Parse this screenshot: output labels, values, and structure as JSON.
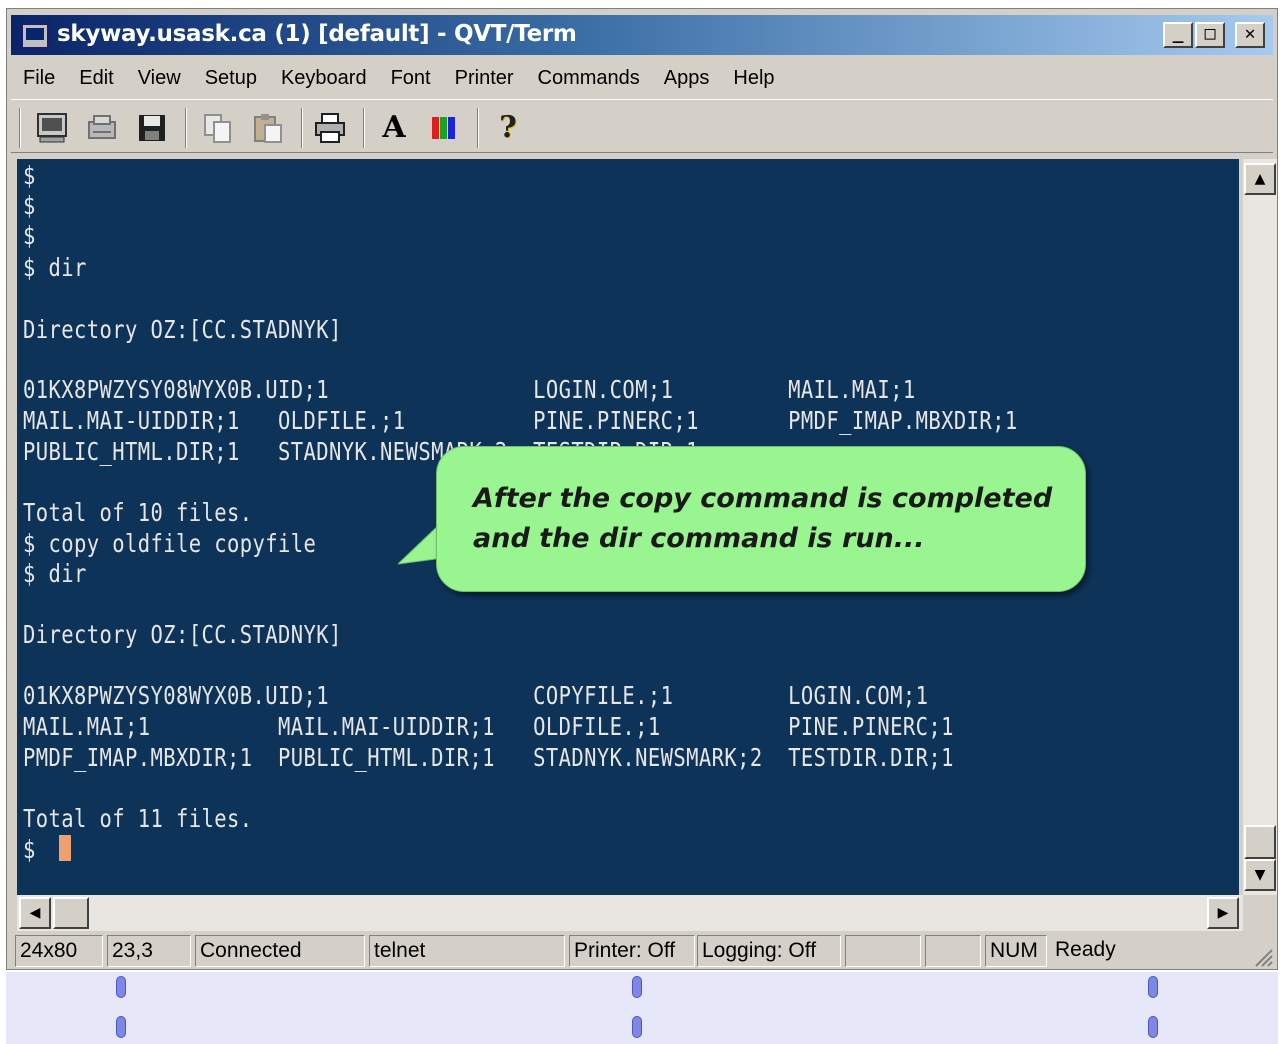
{
  "window": {
    "title": "skyway.usask.ca (1) [default] - QVT/Term",
    "controls": {
      "minimize": "_",
      "maximize": "□",
      "close": "✕"
    }
  },
  "menubar": {
    "items": [
      "File",
      "Edit",
      "View",
      "Setup",
      "Keyboard",
      "Font",
      "Printer",
      "Commands",
      "Apps",
      "Help"
    ]
  },
  "toolbar": {
    "icons": [
      "terminal-icon",
      "connect-icon",
      "save-icon",
      "copy-icon",
      "paste-icon",
      "print-icon",
      "font-icon",
      "color-icon",
      "help-icon"
    ],
    "font_label": "A",
    "help_label": "?"
  },
  "terminal": {
    "lines": [
      "$",
      "$",
      "$",
      "$ dir",
      "",
      "Directory OZ:[CC.STADNYK]",
      "",
      "01KX8PWZYSY08WYX0B.UID;1                LOGIN.COM;1         MAIL.MAI;1",
      "MAIL.MAI-UIDDIR;1   OLDFILE.;1          PINE.PINERC;1       PMDF_IMAP.MBXDIR;1",
      "PUBLIC_HTML.DIR;1   STADNYK.NEWSMARK;2  TESTDIR.DIR;1",
      "",
      "Total of 10 files.",
      "$ copy oldfile copyfile",
      "$ dir",
      "",
      "Directory OZ:[CC.STADNYK]",
      "",
      "01KX8PWZYSY08WYX0B.UID;1                COPYFILE.;1         LOGIN.COM;1",
      "MAIL.MAI;1          MAIL.MAI-UIDDIR;1   OLDFILE.;1          PINE.PINERC;1",
      "PMDF_IMAP.MBXDIR;1  PUBLIC_HTML.DIR;1   STADNYK.NEWSMARK;2  TESTDIR.DIR;1",
      "",
      "Total of 11 files.",
      "$"
    ]
  },
  "callout": {
    "line1": "After the copy command is completed",
    "line2": "and the dir command is run..."
  },
  "scroll": {
    "up": "▲",
    "down": "▼",
    "left": "◀",
    "right": "▶"
  },
  "statusbar": {
    "size": "24x80",
    "cursor_pos": "23,3",
    "connection": "Connected",
    "protocol": "telnet",
    "printer": "Printer: Off",
    "logging": "Logging: Off",
    "empty1": "",
    "empty2": "",
    "num": "NUM",
    "ready": "Ready"
  },
  "colors": {
    "terminal_bg": "#0e3358",
    "terminal_fg": "#e6e6e6",
    "callout_bg": "#99f58f",
    "cursor": "#f0a070"
  }
}
